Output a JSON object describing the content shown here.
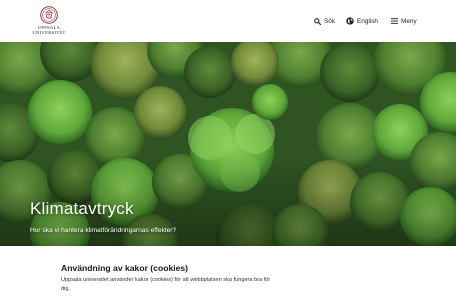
{
  "header": {
    "logo_line1": "UPPSALA",
    "logo_line2": "UNIVERSITET",
    "nav": {
      "search_label": "Sök",
      "language_label": "English",
      "menu_label": "Meny"
    }
  },
  "hero": {
    "title": "Klimatavtryck",
    "subtitle": "Hur ska vi hantera klimatförändringarnas effekter?"
  },
  "cookie": {
    "title": "Användning av kakor (cookies)",
    "body": "Uppsala universitet använder kakor (cookies) för att webbplatsen ska fungera bra för dig."
  },
  "colors": {
    "logo_red": "#a41e22",
    "text_dark": "#222222",
    "forest_green": "#4f8a33"
  }
}
